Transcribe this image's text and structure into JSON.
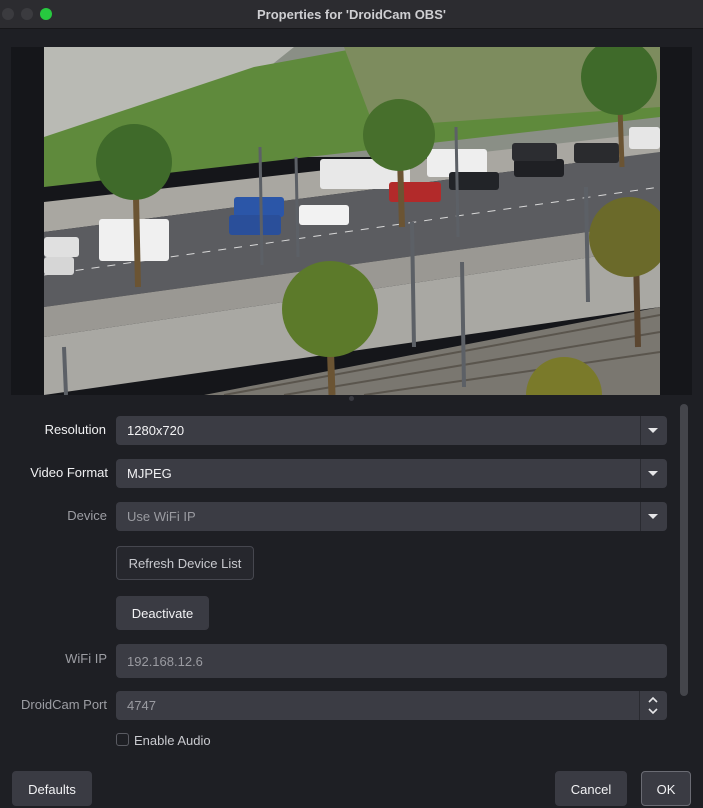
{
  "window": {
    "title": "Properties for 'DroidCam OBS'"
  },
  "preview": {
    "description_icon": "camera-preview-image"
  },
  "form": {
    "resolution": {
      "label": "Resolution",
      "value": "1280x720"
    },
    "video_format": {
      "label": "Video Format",
      "value": "MJPEG"
    },
    "device": {
      "label": "Device",
      "value": "Use WiFi IP"
    },
    "refresh_button": "Refresh Device List",
    "deactivate_button": "Deactivate",
    "wifi_ip": {
      "label": "WiFi IP",
      "value": "192.168.12.6"
    },
    "port": {
      "label": "DroidCam Port",
      "value": "4747"
    },
    "enable_audio": {
      "label": "Enable Audio",
      "checked": false
    }
  },
  "footer": {
    "defaults": "Defaults",
    "cancel": "Cancel",
    "ok": "OK"
  },
  "colors": {
    "background": "#1e1f24",
    "control": "#3b3c44",
    "accent_green": "#27c93f"
  }
}
